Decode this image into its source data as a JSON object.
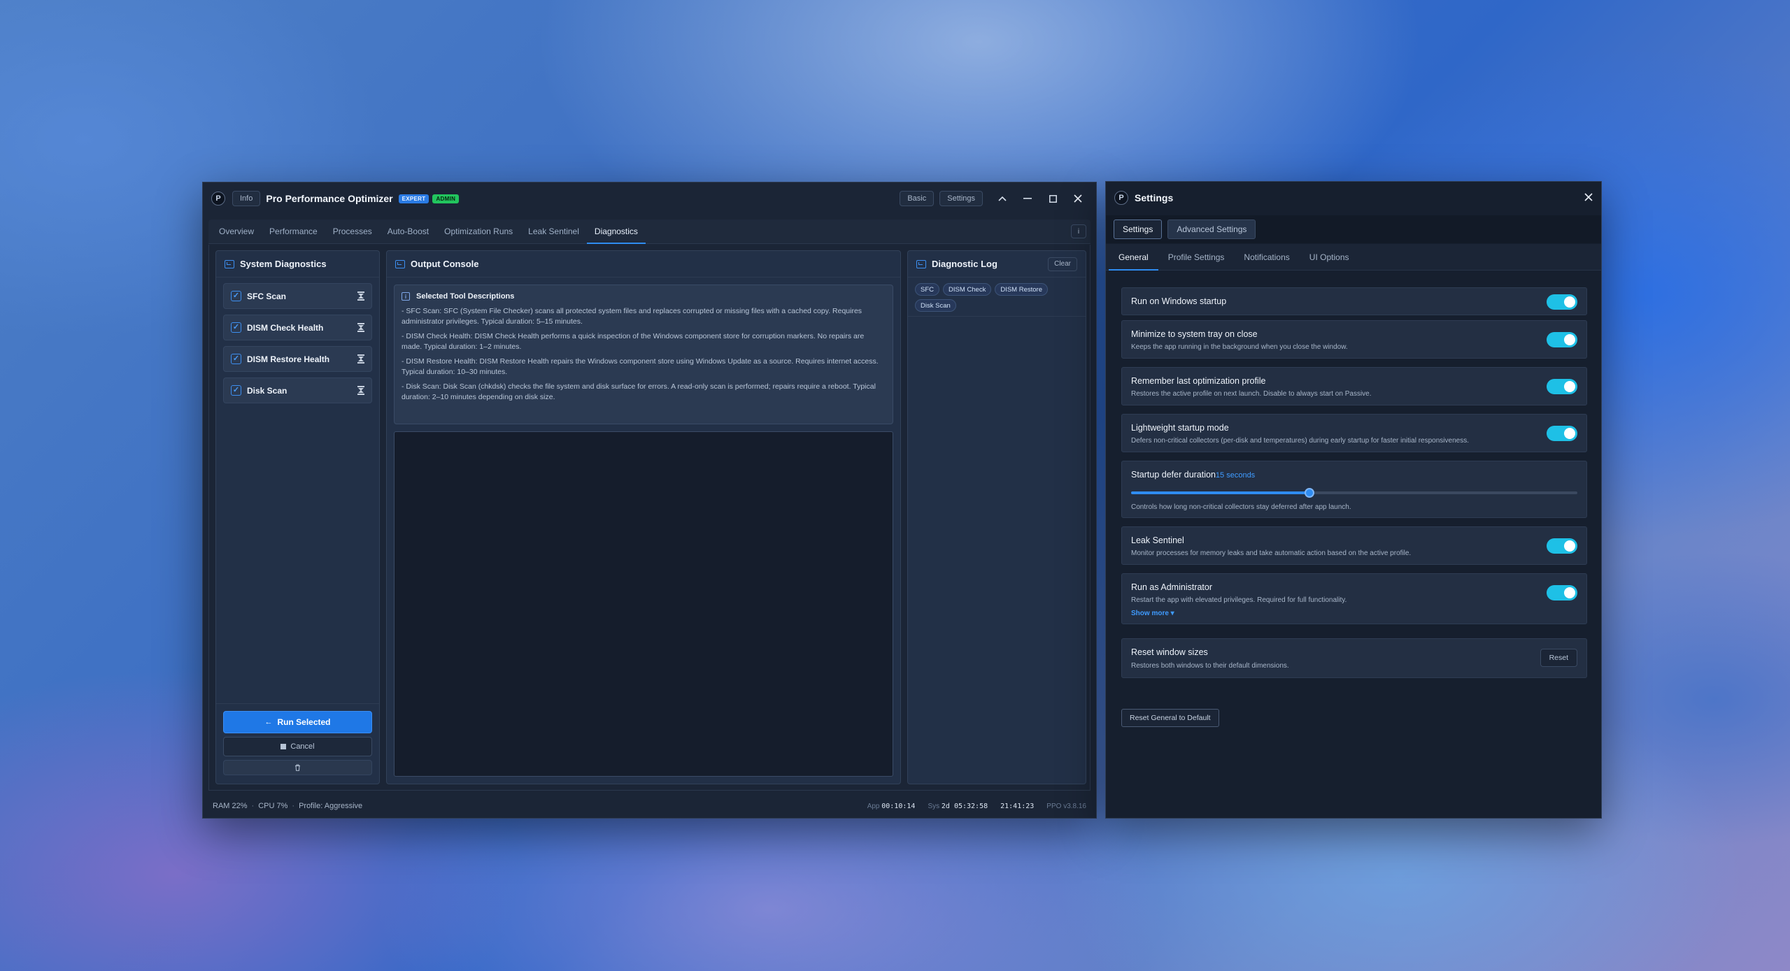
{
  "main_window": {
    "logo": "P",
    "info_button": "Info",
    "title": "Pro Performance Optimizer",
    "badge_expert": "EXPERT",
    "badge_admin": "ADMIN",
    "basic_button": "Basic",
    "settings_button": "Settings",
    "icons": [
      "chevron-up-icon",
      "minimize-icon",
      "maximize-icon",
      "close-icon"
    ]
  },
  "tabs": [
    {
      "label": "Overview"
    },
    {
      "label": "Performance"
    },
    {
      "label": "Processes"
    },
    {
      "label": "Auto-Boost"
    },
    {
      "label": "Optimization Runs"
    },
    {
      "label": "Leak Sentinel"
    },
    {
      "label": "Diagnostics",
      "active": true
    }
  ],
  "tab_info_glyph": "i",
  "diagnostics": {
    "title": "System Diagnostics",
    "items": [
      {
        "label": "SFC Scan",
        "checked": true
      },
      {
        "label": "DISM Check Health",
        "checked": true
      },
      {
        "label": "DISM Restore Health",
        "checked": true
      },
      {
        "label": "Disk Scan",
        "checked": true
      }
    ],
    "run_label": "Run Selected",
    "cancel_label": "Cancel"
  },
  "console": {
    "title": "Output Console",
    "desc_title": "Selected Tool Descriptions",
    "descriptions": [
      "- SFC Scan: SFC (System File Checker) scans all protected system files and replaces corrupted or missing files with a cached copy. Requires administrator privileges. Typical duration: 5–15 minutes.",
      "- DISM Check Health: DISM Check Health performs a quick inspection of the Windows component store for corruption markers. No repairs are made. Typical duration: 1–2 minutes.",
      "- DISM Restore Health: DISM Restore Health repairs the Windows component store using Windows Update as a source. Requires internet access. Typical duration: 10–30 minutes.",
      "- Disk Scan: Disk Scan (chkdsk) checks the file system and disk surface for errors. A read-only scan is performed; repairs require a reboot. Typical duration: 2–10 minutes depending on disk size."
    ]
  },
  "log": {
    "title": "Diagnostic Log",
    "clear_label": "Clear",
    "chips": [
      "SFC",
      "DISM Check",
      "DISM Restore",
      "Disk Scan"
    ]
  },
  "status": {
    "ram": "RAM 22%",
    "cpu": "CPU 7%",
    "profile": "Profile: Aggressive",
    "separator": "·",
    "app_label": "App",
    "app_time": "00:10:14",
    "sys_label": "Sys",
    "sys_time": "2d 05:32:58",
    "clock": "21:41:23",
    "version": "PPO v3.8.16"
  },
  "settings": {
    "logo": "P",
    "title": "Settings",
    "top_tabs": [
      {
        "label": "Settings",
        "active": true
      },
      {
        "label": "Advanced Settings"
      }
    ],
    "sub_tabs": [
      {
        "label": "General",
        "active": true
      },
      {
        "label": "Profile Settings"
      },
      {
        "label": "Notifications"
      },
      {
        "label": "UI Options"
      }
    ],
    "rows": [
      {
        "title": "Run on Windows startup",
        "enabled": true
      },
      {
        "title": "Minimize to system tray on close",
        "desc": "Keeps the app running in the background when you close the window.",
        "enabled": true
      },
      {
        "title": "Remember last optimization profile",
        "desc": "Restores the active profile on next launch. Disable to always start on Passive.",
        "enabled": true
      },
      {
        "title": "Lightweight startup mode",
        "desc": "Defers non-critical collectors (per-disk and temperatures) during early startup for faster initial responsiveness.",
        "enabled": true
      },
      {
        "title": "Leak Sentinel",
        "desc": "Monitor processes for memory leaks and take automatic action based on the active profile.",
        "enabled": true
      },
      {
        "title": "Run as Administrator",
        "desc": "Restart the app with elevated privileges. Required for full functionality.",
        "enabled": true,
        "more": "Show more ▾"
      }
    ],
    "defer": {
      "title": "Startup defer duration",
      "value_text": "15 seconds",
      "fraction": 0.4,
      "desc": "Controls how long non-critical collectors stay deferred after app launch."
    },
    "reset_sizes": {
      "title": "Reset window sizes",
      "desc": "Restores both windows to their default dimensions.",
      "button": "Reset"
    },
    "reset_default": "Reset General to Default",
    "accent": "#1ec0e6"
  }
}
